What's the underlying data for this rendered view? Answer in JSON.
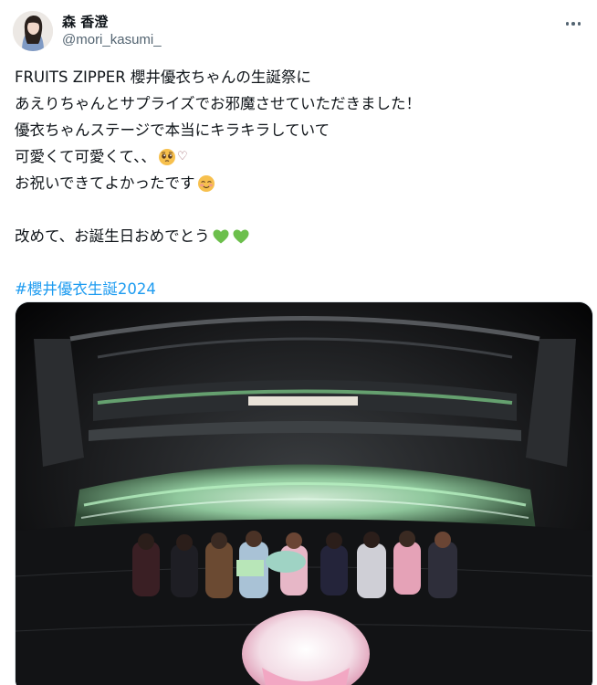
{
  "author": {
    "display_name": "森 香澄",
    "handle": "@mori_kasumi_"
  },
  "tweet": {
    "lines": [
      "FRUITS ZIPPER 櫻井優衣ちゃんの生誕祭に",
      "あえりちゃんとサプライズでお邪魔させていただきました！",
      "優衣ちゃんステージで本当にキラキラしていて",
      "可愛くて可愛くて、、",
      "お祝いできてよかったです",
      "改めて、お誕生日おめでとう"
    ],
    "hashtag": "#櫻井優衣生誕2024",
    "emojis": {
      "line4": [
        "pleading-face-emoji",
        "white-heart"
      ],
      "line5": [
        "smiling-blush-emoji"
      ],
      "line6": [
        "green-heart-emoji",
        "green-heart-emoji"
      ]
    },
    "small_heart": "♡"
  },
  "media": {
    "type": "photo",
    "description_icon": "concert-group-photo"
  },
  "colors": {
    "hashtag": "#1d9bf0",
    "secondary_text": "#536471",
    "green_heart": "#5cb85c"
  }
}
